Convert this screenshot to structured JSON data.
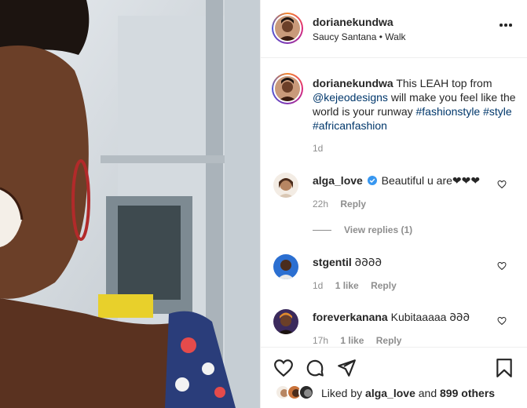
{
  "post": {
    "username": "dorianekundwa",
    "audio": "Saucy Santana",
    "separator": "•",
    "audio_track": "Walk"
  },
  "caption": {
    "username": "dorianekundwa",
    "text_before": "This LEAH top from",
    "mention": "@kejeodesigns",
    "text_after": "will make you feel like the world is your runway",
    "hashtags": [
      "#fashionstyle",
      "#style",
      "#africanfashion"
    ],
    "age": "1d"
  },
  "comments": [
    {
      "username": "alga_love",
      "verified": true,
      "text": "Beautiful u are❤❤❤",
      "age": "22h",
      "likes": "",
      "reply_label": "Reply",
      "view_replies": "View replies (1)"
    },
    {
      "username": "stgentil",
      "verified": false,
      "text": "𐐀𐐀𐐀𐐀",
      "age": "1d",
      "likes": "1 like",
      "reply_label": "Reply"
    },
    {
      "username": "foreverkanana",
      "verified": false,
      "text": "Kubitaaaaa 𐐀𐐀𐐀",
      "age": "17h",
      "likes": "1 like",
      "reply_label": "Reply"
    }
  ],
  "likes": {
    "prefix": "Liked by",
    "liker": "alga_love",
    "joiner": "and",
    "others": "899 others"
  },
  "icons": {
    "like": "heart-icon",
    "comment": "comment-icon",
    "share": "paper-plane-icon",
    "save": "bookmark-icon",
    "more": "more-icon",
    "verified": "verified-badge-icon"
  },
  "colors": {
    "link": "#00376b",
    "secondary_text": "#8e8e8e",
    "verified": "#3897f0"
  }
}
